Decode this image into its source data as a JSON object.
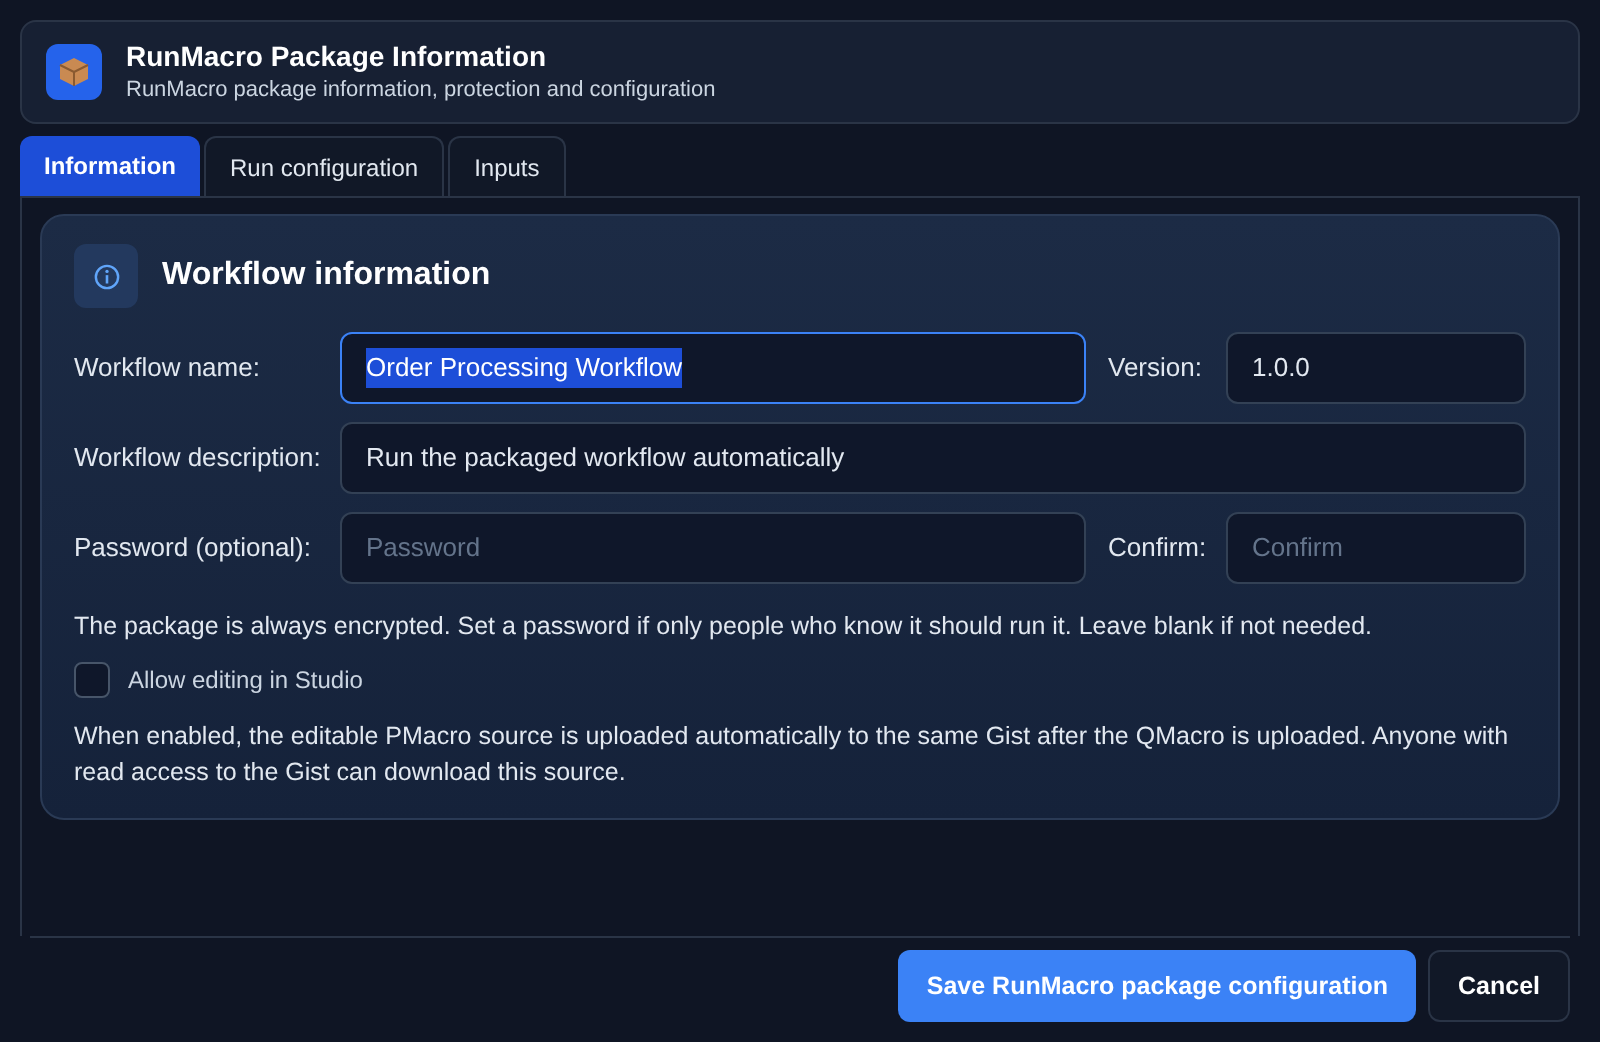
{
  "header": {
    "title": "RunMacro Package Information",
    "subtitle": "RunMacro package information, protection and configuration"
  },
  "tabs": [
    {
      "label": "Information",
      "selected": true
    },
    {
      "label": "Run configuration",
      "selected": false
    },
    {
      "label": "Inputs",
      "selected": false
    }
  ],
  "section": {
    "title": "Workflow information",
    "rows": [
      {
        "fields": [
          {
            "label": "Workflow name:",
            "value": "Order Processing Workflow",
            "focused": true,
            "text_selected": true
          },
          {
            "label": "Version:",
            "value": "1.0.0",
            "focused": false,
            "text_selected": false
          }
        ]
      },
      {
        "fields": [
          {
            "label": "Workflow description:",
            "value": "Run the packaged workflow automatically",
            "focused": false,
            "text_selected": false
          }
        ]
      },
      {
        "fields": [
          {
            "label": "Password (optional):",
            "placeholder": "Password",
            "focused": false
          },
          {
            "label": "Confirm:",
            "placeholder": "Confirm",
            "focused": false
          }
        ]
      }
    ],
    "note": "The package is always encrypted. Set a password if only people who know it should run it. Leave blank if not needed.",
    "checkbox": {
      "label": "Allow editing in Studio",
      "checked": false
    },
    "help": "When enabled, the editable PMacro source is uploaded automatically to the same Gist after the QMacro is uploaded. Anyone with read access to the Gist can download this source."
  },
  "buttons": [
    {
      "label": "Save RunMacro package configuration",
      "kind": "primary"
    },
    {
      "label": "Cancel",
      "kind": "secondary"
    }
  ]
}
